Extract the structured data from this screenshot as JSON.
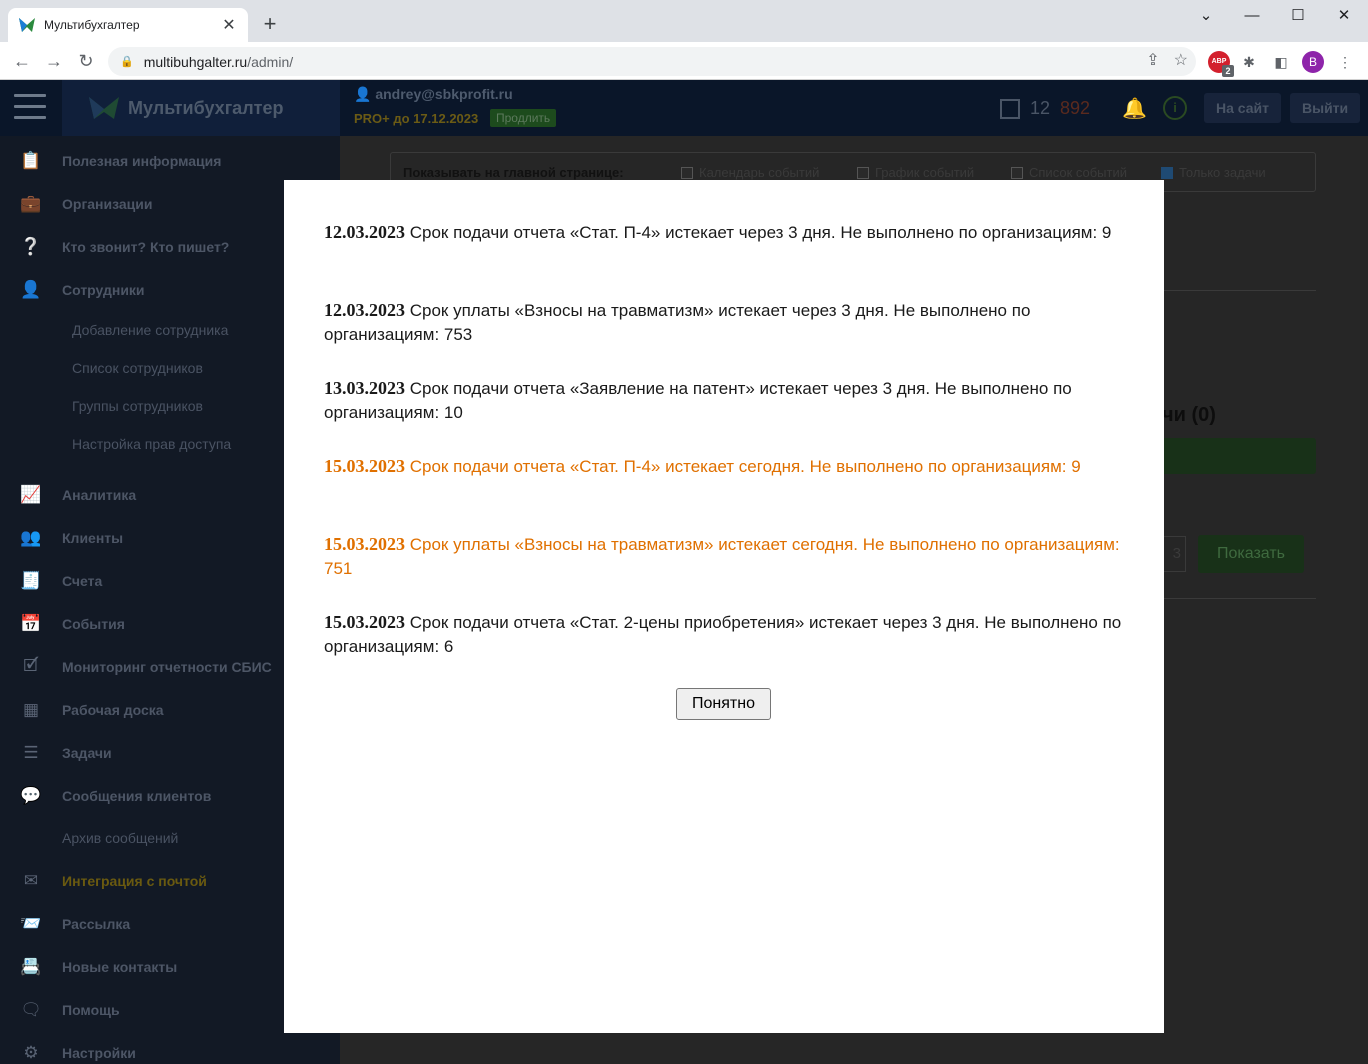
{
  "browser": {
    "tab_title": "Мультибухгалтер",
    "url_host": "multibuhgalter.ru",
    "url_path": "/admin/",
    "extension_badge": "2",
    "profile_initial": "B"
  },
  "header": {
    "brand": "Мультибухгалтер",
    "user_email": "andrey@sbkprofit.ru",
    "plan": "PRO+ до 17.12.2023",
    "renew_label": "Продлить",
    "tasks_done": "12",
    "tasks_overdue": "892",
    "to_site": "На сайт",
    "logout": "Выйти"
  },
  "sidebar": {
    "items": [
      {
        "label": "Полезная информация",
        "icon": "clipboard-icon"
      },
      {
        "label": "Организации",
        "icon": "briefcase-icon"
      },
      {
        "label": "Кто звонит? Кто пишет?",
        "icon": "question-bubble-icon"
      },
      {
        "label": "Сотрудники",
        "icon": "user-icon"
      },
      {
        "label": "Аналитика",
        "icon": "analytics-icon"
      },
      {
        "label": "Клиенты",
        "icon": "clients-icon"
      },
      {
        "label": "Счета",
        "icon": "invoice-icon"
      },
      {
        "label": "События",
        "icon": "calendar-icon"
      },
      {
        "label": "Мониторинг отчетности СБИС",
        "icon": "monitor-check-icon"
      },
      {
        "label": "Рабочая доска",
        "icon": "grid-icon"
      },
      {
        "label": "Задачи",
        "icon": "list-icon"
      },
      {
        "label": "Сообщения клиентов",
        "icon": "chat-icon"
      },
      {
        "label": "Интеграция с почтой",
        "icon": "mail-icon"
      },
      {
        "label": "Рассылка",
        "icon": "send-mail-icon"
      },
      {
        "label": "Новые контакты",
        "icon": "contacts-icon"
      },
      {
        "label": "Помощь",
        "icon": "help-chat-icon"
      },
      {
        "label": "Настройки",
        "icon": "gear-icon"
      }
    ],
    "sub_items": [
      "Добавление сотрудника",
      "Список сотрудников",
      "Группы сотрудников",
      "Настройка прав доступа"
    ],
    "archive": "Архив сообщений"
  },
  "main": {
    "show_label": "Показывать на главной странице:",
    "options": [
      {
        "label": "Календарь событий",
        "checked": false
      },
      {
        "label": "График событий",
        "checked": false
      },
      {
        "label": "Список событий",
        "checked": false
      },
      {
        "label": "Только задачи",
        "checked": true
      }
    ],
    "tasks_header": "чи (0)",
    "date_fragment": "3",
    "show_button": "Показать"
  },
  "modal": {
    "notices": [
      {
        "date": "12.03.2023",
        "text": "Срок подачи отчета «Стат. П-4» истекает через 3 дня. Не выполнено по организациям: 9",
        "urgent": false
      },
      {
        "date": "12.03.2023",
        "text": "Срок уплаты «Взносы на травматизм» истекает через 3 дня. Не выполнено по организациям: 753",
        "urgent": false
      },
      {
        "date": "13.03.2023",
        "text": "Срок подачи отчета «Заявление на патент» истекает через 3 дня. Не выполнено по организациям: 10",
        "urgent": false
      },
      {
        "date": "15.03.2023",
        "text": "Срок подачи отчета «Стат. П-4» истекает сегодня. Не выполнено по организациям: 9",
        "urgent": true
      },
      {
        "date": "15.03.2023",
        "text": "Срок уплаты «Взносы на травматизм» истекает сегодня. Не выполнено по организациям: 751",
        "urgent": true
      },
      {
        "date": "15.03.2023",
        "text": "Срок подачи отчета «Стат. 2-цены приобретения» истекает через 3 дня. Не выполнено по организациям: 6",
        "urgent": false
      }
    ],
    "ok_label": "Понятно"
  }
}
